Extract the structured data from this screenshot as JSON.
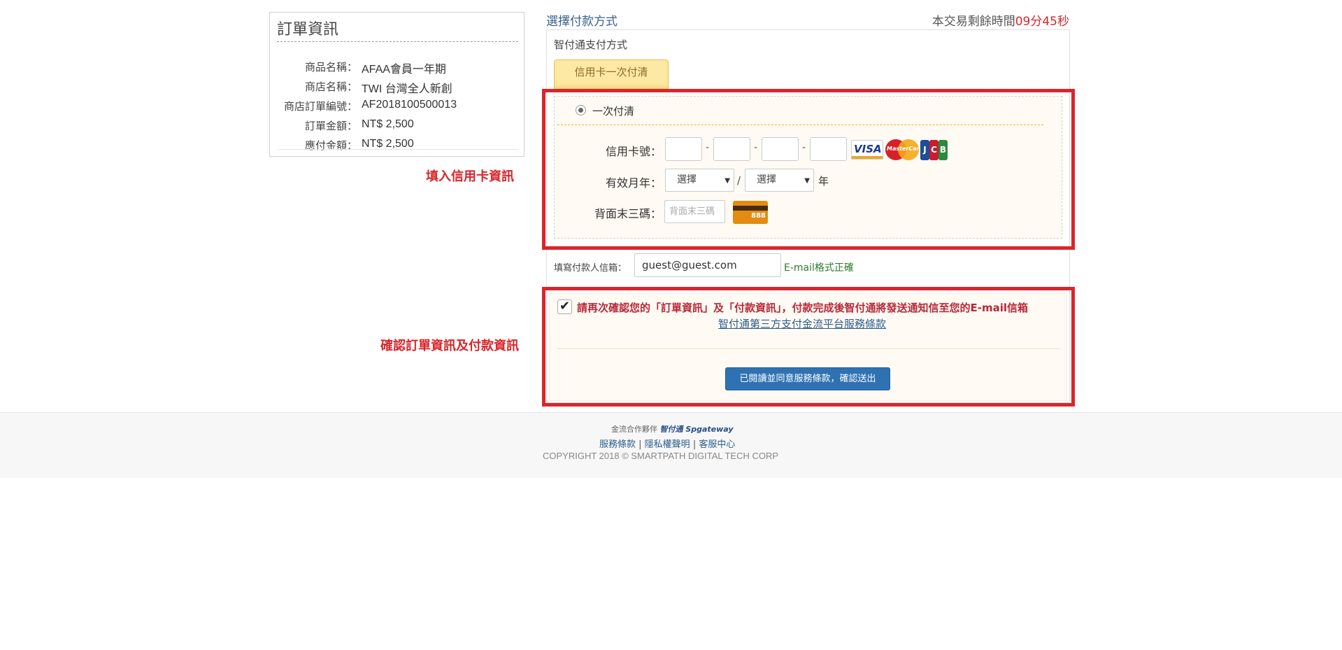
{
  "order": {
    "title": "訂單資訊",
    "rows": [
      {
        "label": "商品名稱：",
        "value": "AFAA會員一年期"
      },
      {
        "label": "商店名稱：",
        "value": "TWI 台灣全人新創"
      },
      {
        "label": "商店訂單編號：",
        "value": "AF2018100500013"
      },
      {
        "label": "訂單金額：",
        "value": "NT$ 2,500"
      },
      {
        "label": "應付金額：",
        "value": "NT$ 2,500"
      }
    ]
  },
  "annotations": {
    "fill_card": "填入信用卡資訊",
    "confirm": "確認訂單資訊及付款資訊",
    "color": "#d9262b"
  },
  "payment": {
    "title": "選擇付款方式",
    "timer_prefix": "本交易剩餘時間",
    "timer_min": "09",
    "timer_min_unit": "分",
    "timer_sec": "45",
    "timer_sec_unit": "秒",
    "method_title": "智付通支付方式",
    "tab_label": "信用卡一次付清",
    "radio_label": "一次付清",
    "card_number_label": "信用卡號：",
    "card_sep": "-",
    "expiry_label": "有效月年：",
    "month_select": "選擇",
    "year_select": "選擇",
    "expiry_sep": "/",
    "year_unit": "年",
    "cvv_label": "背面末三碼：",
    "cvv_placeholder": "背面末三碼",
    "cvv_icon_text": "888",
    "card_logos": {
      "visa": "VISA",
      "mastercard": "MasterCard",
      "jcb": [
        "J",
        "C",
        "B"
      ]
    }
  },
  "email": {
    "label": "填寫付款人信箱：",
    "value": "guest@guest.com",
    "status": "E-mail格式正確"
  },
  "confirm": {
    "checked": true,
    "text": "請再次確認您的「訂單資訊」及「付款資訊」，付款完成後智付通將發送通知信至您的E-mail信箱",
    "terms_link": "智付通第三方支付金流平台服務條款",
    "submit_label": "已閱讀並同意服務條款，確認送出"
  },
  "footer": {
    "partner_label": "金流合作夥伴",
    "partner_brand": "智付通 Spgateway",
    "links": [
      "服務條款",
      "隱私權聲明",
      "客服中心"
    ],
    "link_sep": " | ",
    "copyright": "COPYRIGHT 2018 © SMARTPATH DIGITAL TECH CORP"
  },
  "colors": {
    "accent_red": "#d9262b",
    "link_blue": "#2a5e8c",
    "button_blue": "#2f72b3",
    "tab_yellow": "#fde9a3"
  }
}
